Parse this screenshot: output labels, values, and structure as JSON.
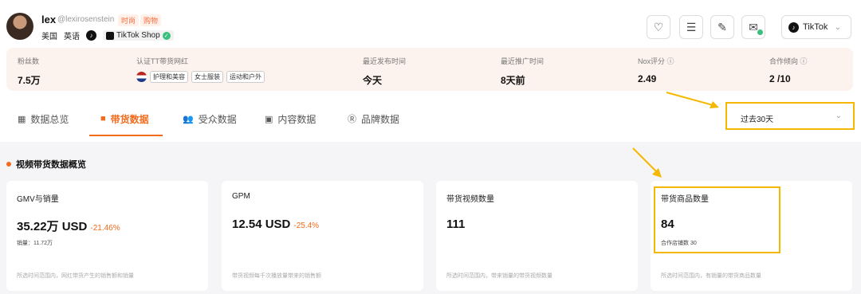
{
  "profile": {
    "username": "lex",
    "handle": "@lexirosenstein",
    "tags": [
      "时尚",
      "购物"
    ],
    "country": "美国",
    "language": "英语",
    "shop_label": "TikTok Shop"
  },
  "header_icons": [
    "heart-icon",
    "list-icon",
    "edit-icon",
    "mail-icon"
  ],
  "platform": {
    "label": "TikTok"
  },
  "stats": {
    "fans": {
      "label": "粉丝数",
      "value": "7.5万"
    },
    "certified": {
      "label": "认证TT带货网红",
      "chips": [
        "护理和美容",
        "女士服装",
        "运动和户外"
      ]
    },
    "last_post": {
      "label": "最近发布时间",
      "value": "今天"
    },
    "last_promo": {
      "label": "最近推广时间",
      "value": "8天前"
    },
    "nox": {
      "label": "Nox评分",
      "value": "2.49"
    },
    "coop": {
      "label": "合作倾向",
      "value": "2 /10"
    }
  },
  "tabs": [
    {
      "label": "数据总览",
      "icon": "grid-icon"
    },
    {
      "label": "带货数据",
      "icon": "bag-icon"
    },
    {
      "label": "受众数据",
      "icon": "people-icon"
    },
    {
      "label": "内容数据",
      "icon": "video-icon"
    },
    {
      "label": "品牌数据",
      "icon": "brand-icon"
    }
  ],
  "active_tab": "带货数据",
  "period": {
    "selected": "过去30天"
  },
  "section": {
    "title": "视频带货数据概览"
  },
  "cards": [
    {
      "title": "GMV与销量",
      "value": "35.22万 USD",
      "change": "-21.46%",
      "sub": "销量：11.72万",
      "foot": "所选时间范围内，网红带货产生的销售额和销量"
    },
    {
      "title": "GPM",
      "value": "12.54 USD",
      "change": "-25.4%",
      "sub": "",
      "foot": "带货视频每千次播放量带来的销售额"
    },
    {
      "title": "带货视频数量",
      "value": "111",
      "change": "",
      "sub": "",
      "foot": "所选时间范围内，带来销量的带货视频数量"
    },
    {
      "title": "带货商品数量",
      "value": "84",
      "change": "",
      "sub": "合作店铺数 30",
      "foot": "所选时间范围内，有销量的带货商品数量"
    }
  ],
  "colors": {
    "accent": "#f26b1d",
    "highlight": "#f5b800",
    "verified": "#3bbf7d"
  }
}
